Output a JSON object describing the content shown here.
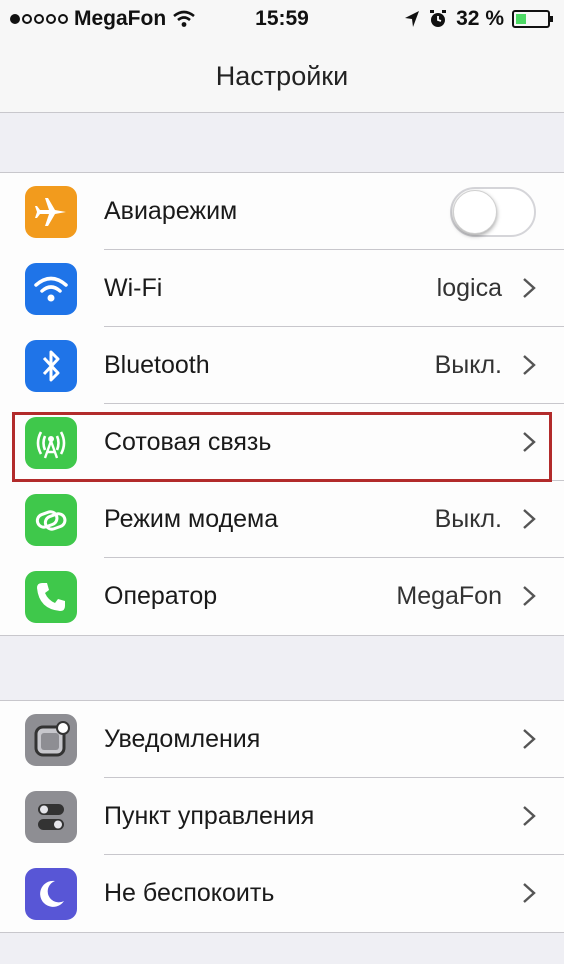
{
  "status_bar": {
    "carrier": "MegaFon",
    "time": "15:59",
    "battery_percent": "32 %",
    "battery_level": 0.32,
    "signal_dots_filled": 1,
    "signal_dots_total": 5,
    "icons": [
      "wifi-icon",
      "location-arrow-icon",
      "alarm-icon",
      "battery-icon"
    ]
  },
  "nav": {
    "title": "Настройки"
  },
  "group1": [
    {
      "label": "Авиарежим",
      "value": "",
      "icon": "airplane-icon",
      "color": "#f29b1d",
      "control": "toggle",
      "toggle_on": false
    },
    {
      "label": "Wi-Fi",
      "value": "logica",
      "icon": "wifi-icon",
      "color": "#1f74e8",
      "control": "chevron"
    },
    {
      "label": "Bluetooth",
      "value": "Выкл.",
      "icon": "bluetooth-icon",
      "color": "#1f74e8",
      "control": "chevron"
    },
    {
      "label": "Сотовая связь",
      "value": "",
      "icon": "cellular-antenna-icon",
      "color": "#3fc84b",
      "control": "chevron",
      "highlighted": true
    },
    {
      "label": "Режим модема",
      "value": "Выкл.",
      "icon": "hotspot-chain-icon",
      "color": "#3fc84b",
      "control": "chevron"
    },
    {
      "label": "Оператор",
      "value": "MegaFon",
      "icon": "phone-icon",
      "color": "#3fc84b",
      "control": "chevron"
    }
  ],
  "group2": [
    {
      "label": "Уведомления",
      "value": "",
      "icon": "notifications-icon",
      "color": "#8e8e93",
      "control": "chevron"
    },
    {
      "label": "Пункт управления",
      "value": "",
      "icon": "control-center-icon",
      "color": "#8e8e93",
      "control": "chevron"
    },
    {
      "label": "Не беспокоить",
      "value": "",
      "icon": "moon-icon",
      "color": "#5856d6",
      "control": "chevron"
    }
  ],
  "colors": {
    "highlight_border": "#b22b2b",
    "battery_fill": "#4cd964"
  }
}
